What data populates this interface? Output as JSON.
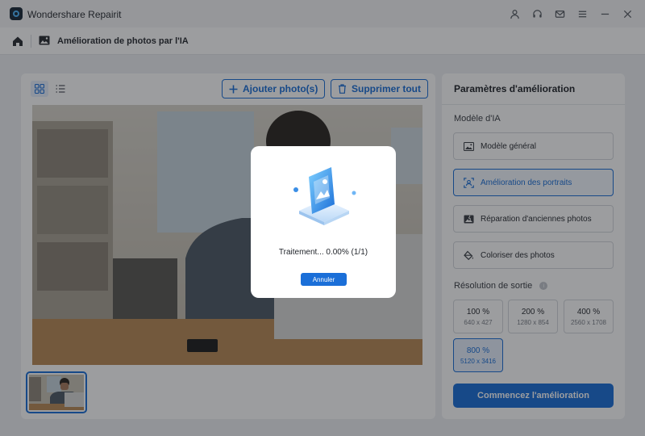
{
  "app": {
    "title": "Wondershare Repairit"
  },
  "window_icons": [
    "user-icon",
    "headset-icon",
    "mail-icon",
    "menu-icon",
    "minimize-icon",
    "close-icon"
  ],
  "nav": {
    "page_title": "Amélioration de photos par l'IA"
  },
  "toolbar": {
    "add_label": "Ajouter photo(s)",
    "delete_label": "Supprimer tout"
  },
  "settings": {
    "title": "Paramètres d'amélioration",
    "model_label": "Modèle d'IA",
    "models": [
      {
        "label": "Modèle général",
        "icon": "image-icon",
        "selected": false
      },
      {
        "label": "Amélioration des portraits",
        "icon": "face-scan-icon",
        "selected": true
      },
      {
        "label": "Réparation d'anciennes photos",
        "icon": "old-photo-icon",
        "selected": false
      },
      {
        "label": "Coloriser des photos",
        "icon": "paint-bucket-icon",
        "selected": false
      }
    ],
    "resolution_label": "Résolution de sortie",
    "resolutions": [
      {
        "value": "100 %",
        "size": "640 x 427",
        "selected": false
      },
      {
        "value": "200 %",
        "size": "1280 x 854",
        "selected": false
      },
      {
        "value": "400 %",
        "size": "2560 x 1708",
        "selected": false
      },
      {
        "value": "800 %",
        "size": "5120 x 3416",
        "selected": true
      }
    ],
    "start_label": "Commencez l'amélioration"
  },
  "modal": {
    "status": "Traitement... 0.00% (1/1)",
    "cancel_label": "Annuler"
  },
  "colors": {
    "accent": "#1b6fd8",
    "selected_bg": "#e7f0fd"
  }
}
